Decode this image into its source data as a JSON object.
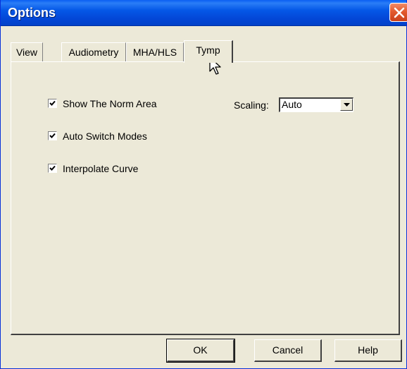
{
  "window": {
    "title": "Options"
  },
  "tabs": [
    {
      "label": "View",
      "active": false
    },
    {
      "label": "Audiometry",
      "active": false
    },
    {
      "label": "MHA/HLS",
      "active": false
    },
    {
      "label": "Tymp",
      "active": true
    }
  ],
  "options": {
    "show_norm_area": {
      "label": "Show The Norm Area",
      "checked": true
    },
    "auto_switch_modes": {
      "label": "Auto Switch Modes",
      "checked": true
    },
    "interpolate_curve": {
      "label": "Interpolate Curve",
      "checked": true
    }
  },
  "scaling": {
    "label": "Scaling:",
    "value": "Auto"
  },
  "buttons": {
    "ok": "OK",
    "cancel": "Cancel",
    "help": "Help"
  },
  "colors": {
    "titlebar": "#0558e7",
    "close": "#e35a2e",
    "face": "#ece9d8"
  }
}
